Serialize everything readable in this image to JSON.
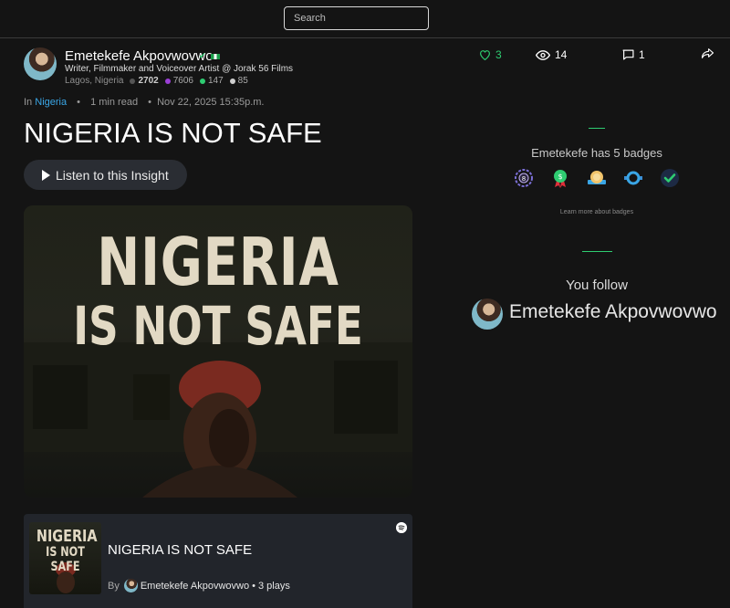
{
  "search": {
    "placeholder": "Search"
  },
  "author": {
    "name": "Emetekefe Akpovwovwo",
    "bio": "Writer, Filmmaker and Voiceover Artist @ Jorak 56 Films",
    "location": "Lagos, Nigeria",
    "stats": [
      {
        "value": "2702",
        "color": "#555555"
      },
      {
        "value": "7606",
        "color": "#9b3fd6"
      },
      {
        "value": "147",
        "color": "#2ecc71"
      },
      {
        "value": "85",
        "color": "#cfcfcf"
      }
    ]
  },
  "actions": {
    "likes": "3",
    "views": "14",
    "comments": "1"
  },
  "post": {
    "in_label": "In",
    "category": "Nigeria",
    "read_time": "1 min read",
    "date": "Nov 22, 2025 15:35p.m.",
    "title": "NIGERIA IS NOT SAFE",
    "listen_label": "Listen to this Insight",
    "cover_line1": "NIGERIA",
    "cover_line2": "IS NOT SAFE"
  },
  "audio": {
    "title": "NIGERIA IS NOT SAFE",
    "by_label": "By",
    "author": "Emetekefe Akpovwovwo",
    "plays": "• 3 plays",
    "thumb_line1": "NIGERIA",
    "thumb_line2": "IS NOT SAFE"
  },
  "sidebar": {
    "badges_title": "Emetekefe has 5 badges",
    "badges": [
      "laurel-badge-icon",
      "dollar-medal-icon",
      "ribbon-badge-icon",
      "blue-ring-badge-icon",
      "checkmark-badge-icon"
    ],
    "learn_more": "Learn more about badges",
    "follow_title": "You follow",
    "follow_name": "Emetekefe Akpovwovwo"
  },
  "colors": {
    "accent_green": "#2ecc71",
    "link_blue": "#3aa6e6",
    "background": "#141414"
  }
}
